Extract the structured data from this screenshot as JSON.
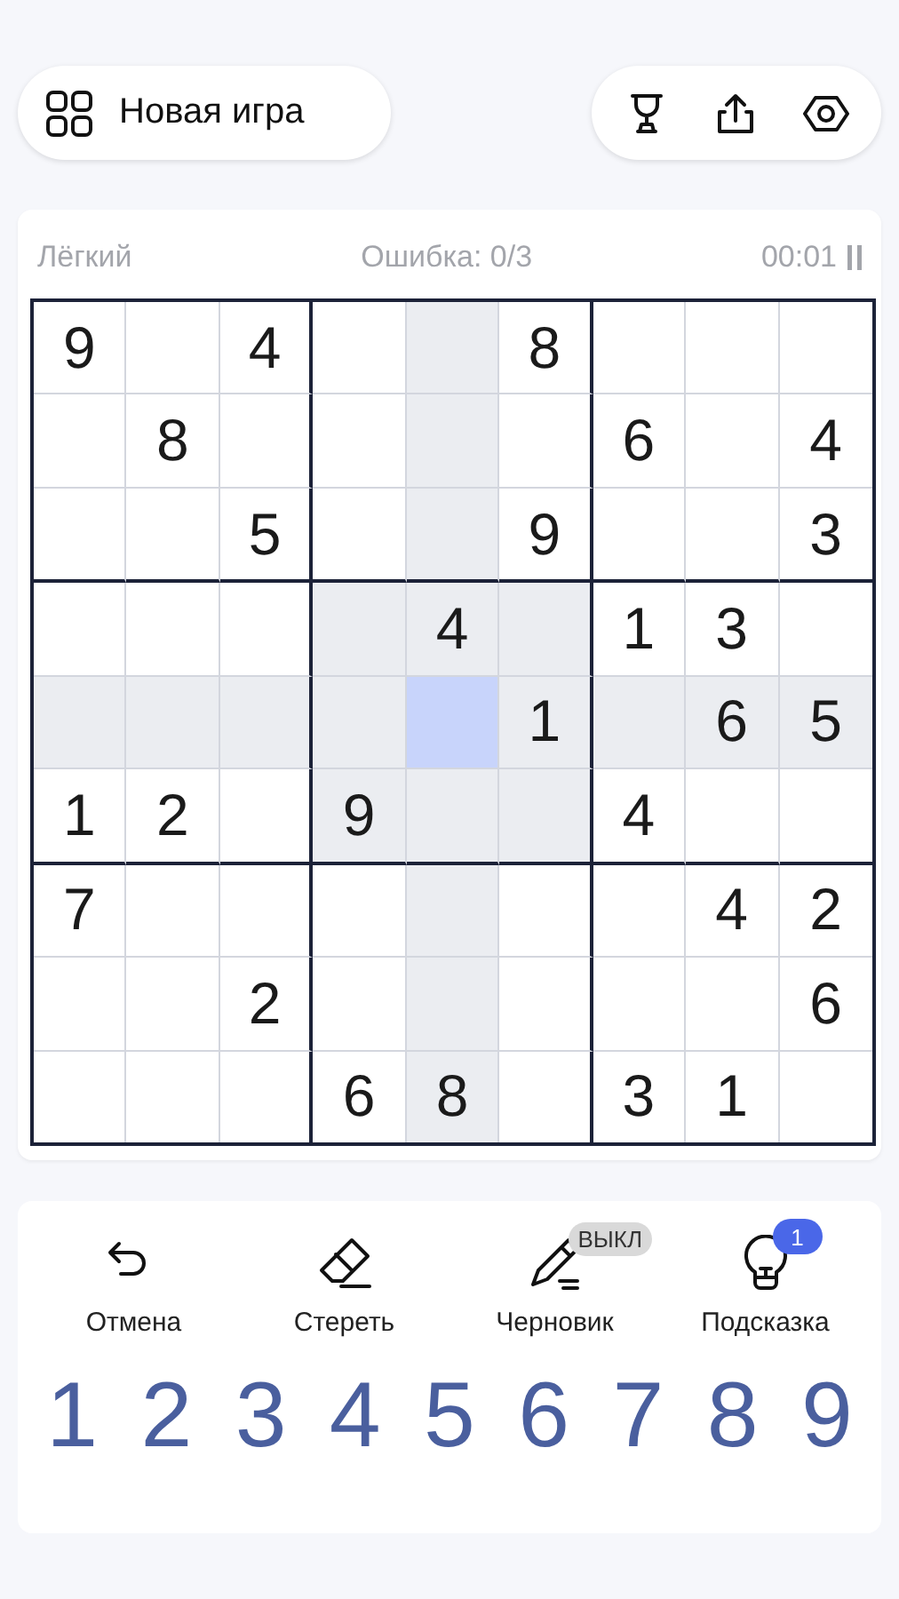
{
  "top_bar": {
    "new_game": "Новая игра"
  },
  "status": {
    "difficulty": "Лёгкий",
    "mistakes": "Ошибка: 0/3",
    "timer": "00:01"
  },
  "board": {
    "rows": [
      [
        {
          "value": "9",
          "selected": false
        },
        {
          "selected": false
        },
        {
          "value": "4",
          "selected": false
        },
        {
          "selected": false
        },
        {
          "selected": false
        },
        {
          "value": "8",
          "selected": false
        },
        {
          "selected": false
        },
        {
          "selected": false
        },
        {
          "selected": false
        }
      ],
      [
        {
          "selected": false
        },
        {
          "value": "8",
          "selected": false
        },
        {
          "selected": false
        },
        {
          "selected": false
        },
        {
          "selected": false
        },
        {
          "selected": false
        },
        {
          "value": "6",
          "selected": false
        },
        {
          "selected": false
        },
        {
          "value": "4",
          "selected": false
        }
      ],
      [
        {
          "selected": false
        },
        {
          "selected": false
        },
        {
          "value": "5",
          "selected": false
        },
        {
          "selected": false
        },
        {
          "selected": false
        },
        {
          "value": "9",
          "selected": false
        },
        {
          "selected": false
        },
        {
          "selected": false
        },
        {
          "value": "3",
          "selected": false
        }
      ],
      [
        {
          "selected": false
        },
        {
          "selected": false
        },
        {
          "selected": false
        },
        {
          "selected": false
        },
        {
          "value": "4",
          "selected": false
        },
        {
          "selected": false
        },
        {
          "value": "1",
          "selected": false
        },
        {
          "value": "3",
          "selected": false
        },
        {
          "selected": false
        }
      ],
      [
        {
          "selected": false
        },
        {
          "selected": false
        },
        {
          "selected": false
        },
        {
          "selected": false
        },
        {
          "selected": true
        },
        {
          "value": "1",
          "selected": false
        },
        {
          "selected": false
        },
        {
          "value": "6",
          "selected": false
        },
        {
          "value": "5",
          "selected": false
        }
      ],
      [
        {
          "value": "1",
          "selected": false
        },
        {
          "value": "2",
          "selected": false
        },
        {
          "selected": false
        },
        {
          "value": "9",
          "selected": false
        },
        {
          "selected": false
        },
        {
          "selected": false
        },
        {
          "value": "4",
          "selected": false
        },
        {
          "selected": false
        },
        {
          "selected": false
        }
      ],
      [
        {
          "value": "7",
          "selected": false
        },
        {
          "selected": false
        },
        {
          "selected": false
        },
        {
          "selected": false
        },
        {
          "selected": false
        },
        {
          "selected": false
        },
        {
          "selected": false
        },
        {
          "value": "4",
          "selected": false
        },
        {
          "value": "2",
          "selected": false
        }
      ],
      [
        {
          "selected": false
        },
        {
          "selected": false
        },
        {
          "value": "2",
          "selected": false
        },
        {
          "selected": false
        },
        {
          "selected": false
        },
        {
          "selected": false
        },
        {
          "selected": false
        },
        {
          "selected": false
        },
        {
          "value": "6",
          "selected": false
        }
      ],
      [
        {
          "selected": false
        },
        {
          "selected": false
        },
        {
          "selected": false
        },
        {
          "value": "6",
          "selected": false
        },
        {
          "value": "8",
          "selected": false
        },
        {
          "selected": false
        },
        {
          "value": "3",
          "selected": false
        },
        {
          "value": "1",
          "selected": false
        },
        {
          "selected": false
        }
      ]
    ]
  },
  "tools": [
    {
      "kind": "undo",
      "label": "Отмена"
    },
    {
      "kind": "erase",
      "label": "Стереть"
    },
    {
      "kind": "draft",
      "label": "Черновик",
      "badge": "ВЫКЛ"
    },
    {
      "kind": "hint",
      "label": "Подсказка",
      "count": "1"
    }
  ],
  "numbers": [
    "1",
    "2",
    "3",
    "4",
    "5",
    "6",
    "7",
    "8",
    "9"
  ]
}
